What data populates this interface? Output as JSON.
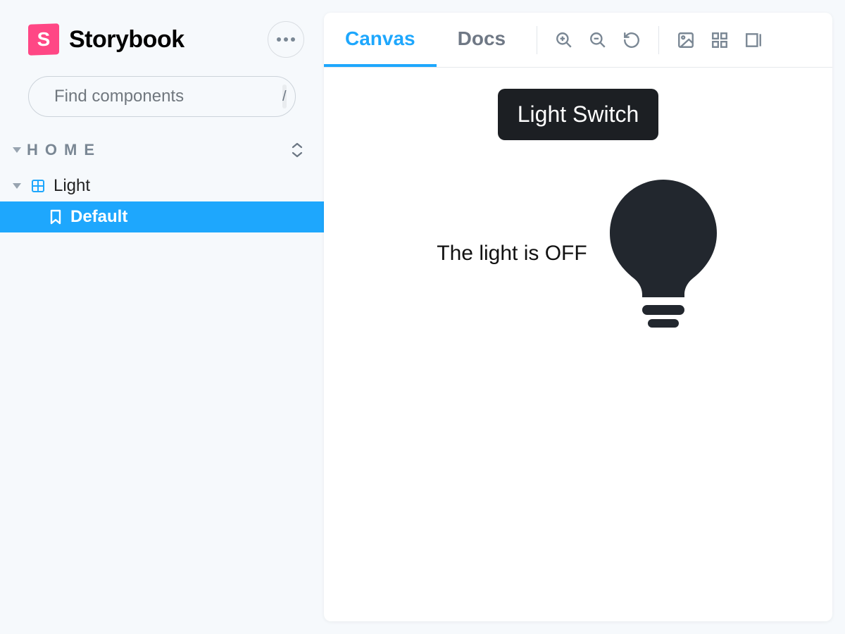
{
  "brand": {
    "name": "Storybook",
    "logo_letter": "S"
  },
  "search": {
    "placeholder": "Find components",
    "shortcut": "/"
  },
  "section": {
    "title": "HOME"
  },
  "tree": {
    "component": {
      "label": "Light"
    },
    "story": {
      "label": "Default"
    }
  },
  "tabs": {
    "canvas": "Canvas",
    "docs": "Docs",
    "active": "canvas"
  },
  "canvas": {
    "button_label": "Light Switch",
    "status_text": "The light is OFF"
  }
}
